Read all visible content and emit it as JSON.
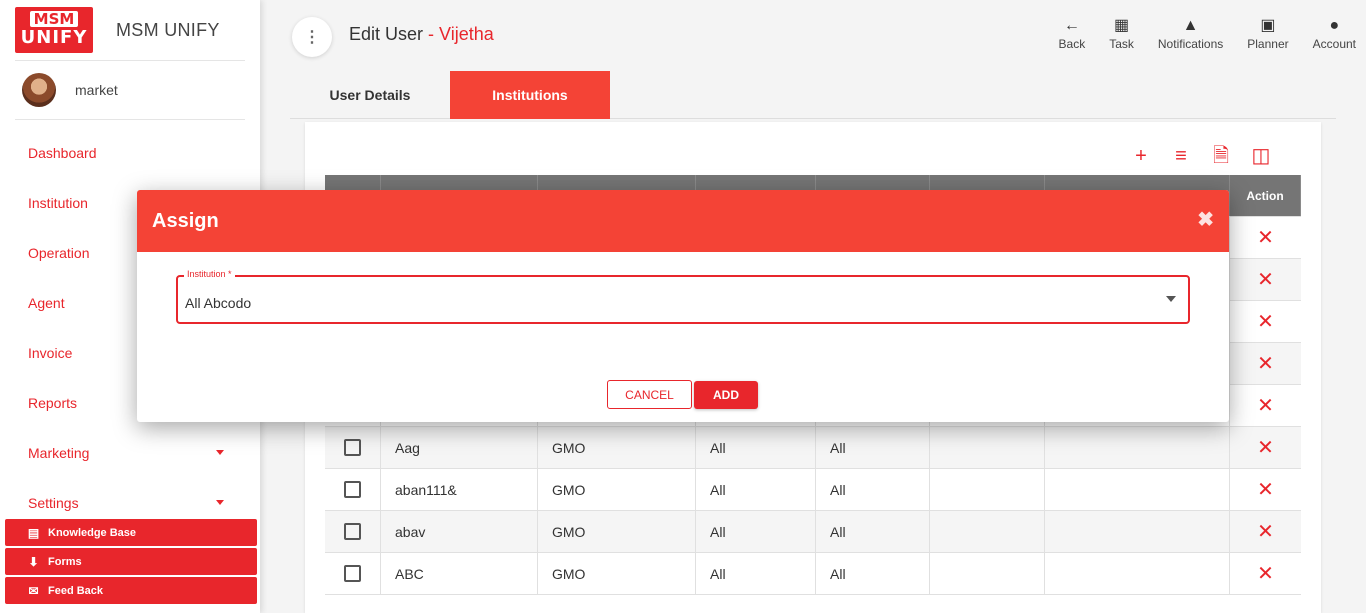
{
  "brand": {
    "logo_top": "MSM",
    "logo_bottom": "UNIFY",
    "name": "MSM UNIFY"
  },
  "user": {
    "name": "market"
  },
  "sidebar": {
    "items": [
      {
        "label": "Dashboard"
      },
      {
        "label": "Institution"
      },
      {
        "label": "Operation"
      },
      {
        "label": "Agent"
      },
      {
        "label": "Invoice"
      },
      {
        "label": "Reports"
      },
      {
        "label": "Marketing"
      },
      {
        "label": "Settings"
      }
    ],
    "quick": [
      {
        "label": "Knowledge Base",
        "icon": "book-icon"
      },
      {
        "label": "Forms",
        "icon": "download-icon"
      },
      {
        "label": "Feed Back",
        "icon": "feedback-icon"
      }
    ]
  },
  "header": {
    "title": "Edit User",
    "subtitle": " - Vijetha",
    "actions": [
      {
        "label": "Back",
        "icon": "back-arrow-icon"
      },
      {
        "label": "Task",
        "icon": "clipboard-icon"
      },
      {
        "label": "Notifications",
        "icon": "bell-icon"
      },
      {
        "label": "Planner",
        "icon": "calendar-icon"
      },
      {
        "label": "Account",
        "icon": "person-icon"
      }
    ]
  },
  "tabs": [
    {
      "label": "User Details"
    },
    {
      "label": "Institutions"
    }
  ],
  "table": {
    "action_header": "Action",
    "rows": [
      [
        "Aag",
        "GMO",
        "All",
        "All"
      ],
      [
        "aban111&",
        "GMO",
        "All",
        "All"
      ],
      [
        "abav",
        "GMO",
        "All",
        "All"
      ],
      [
        "ABC",
        "GMO",
        "All",
        "All"
      ]
    ]
  },
  "modal": {
    "title": "Assign",
    "field_label": "Institution *",
    "field_value": "All Abcodo",
    "cancel": "CANCEL",
    "add": "ADD"
  },
  "colors": {
    "accent": "#e8262c",
    "tab_active": "#f44336",
    "table_header": "#757575"
  }
}
